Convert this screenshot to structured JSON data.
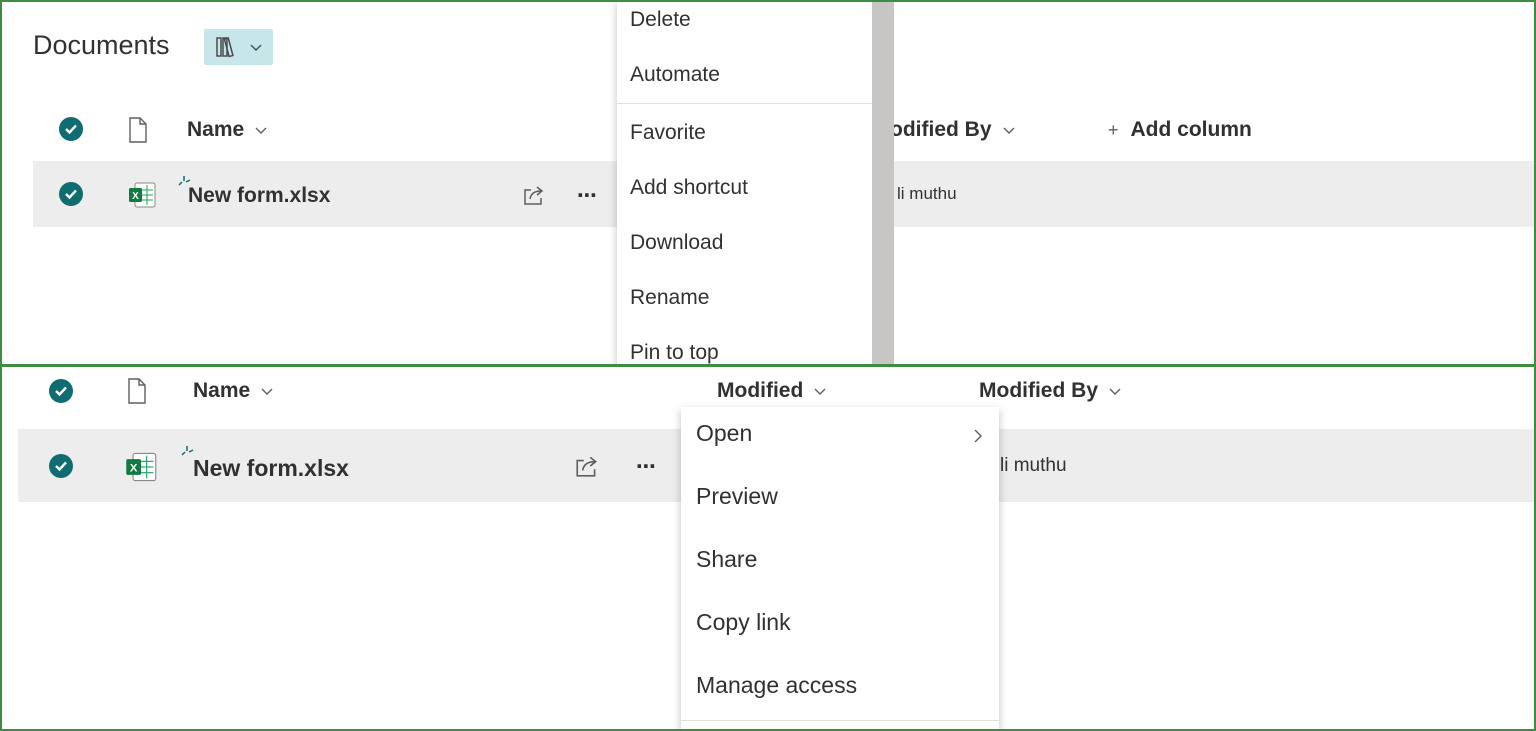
{
  "top": {
    "title": "Documents",
    "view_icon": "library-icon",
    "headers": {
      "name": "Name",
      "modified_by": "odified By",
      "add_column": "Add column"
    },
    "row": {
      "file_name": "New form.xlsx",
      "file_icon": "excel-icon",
      "modified_by": "li muthu"
    },
    "menu": {
      "items": [
        {
          "label": "Delete"
        },
        {
          "label": "Automate"
        },
        {
          "label": "Favorite"
        },
        {
          "label": "Add shortcut"
        },
        {
          "label": "Download"
        },
        {
          "label": "Rename"
        },
        {
          "label": "Pin to top"
        }
      ]
    }
  },
  "bottom": {
    "headers": {
      "name": "Name",
      "modified": "Modified",
      "modified_by": "Modified By"
    },
    "row": {
      "file_name": "New form.xlsx",
      "file_icon": "excel-icon",
      "modified_by": "li muthu"
    },
    "menu": {
      "items": [
        {
          "label": "Open"
        },
        {
          "label": "Preview"
        },
        {
          "label": "Share"
        },
        {
          "label": "Copy link"
        },
        {
          "label": "Manage access"
        }
      ]
    }
  },
  "colors": {
    "border": "#3e8e41",
    "accent": "#0f6c70",
    "row_bg": "#ededed",
    "view_btn_bg": "#c7e6ea"
  }
}
